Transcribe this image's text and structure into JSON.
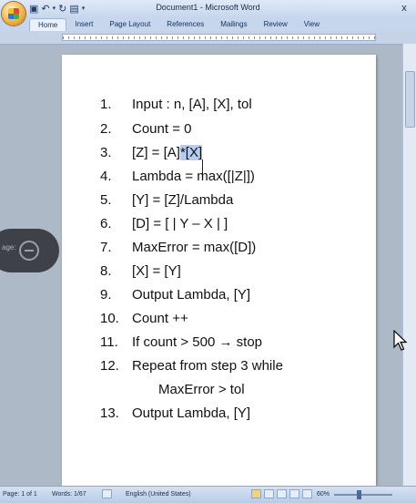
{
  "window": {
    "title": "Document1 - Microsoft Word",
    "close_glyph": "x"
  },
  "ribbon": {
    "tabs": [
      "Home",
      "Insert",
      "Page Layout",
      "References",
      "Mailings",
      "Review",
      "View"
    ]
  },
  "document": {
    "lines": [
      {
        "num": "1.",
        "text": "Input : n, [A], [X], tol"
      },
      {
        "num": "2.",
        "text": "Count = 0"
      },
      {
        "num": "3.",
        "text_before": "[Z] = [A]",
        "text_selected": "*[X]"
      },
      {
        "num": "4.",
        "text": "Lambda = max([|Z|])"
      },
      {
        "num": "5.",
        "text": "[Y] = [Z]/Lambda"
      },
      {
        "num": "6.",
        "text": "[D] = [ | Y – X | ]"
      },
      {
        "num": "7.",
        "text": "MaxError = max([D])"
      },
      {
        "num": "8.",
        "text": "[X] = [Y]"
      },
      {
        "num": "9.",
        "text": "Output Lambda, [Y]"
      },
      {
        "num": "10.",
        "text": "Count ++"
      },
      {
        "num": "11.",
        "text": "If count > 500 → stop"
      },
      {
        "num": "12.",
        "text": "Repeat from step 3 while"
      },
      {
        "num": "",
        "text": "MaxError > tol"
      },
      {
        "num": "13.",
        "text": "Output Lambda, [Y]"
      }
    ]
  },
  "overlay": {
    "label": "age:"
  },
  "statusbar": {
    "page": "Page: 1 of 1",
    "words": "Words: 1/67",
    "language": "English (United States)",
    "zoom": "60%"
  },
  "icons": {
    "save": "save-icon",
    "undo": "undo-icon",
    "redo": "redo-icon",
    "print_preview": "print-preview-icon",
    "proofing": "proofing-icon",
    "zoom_out": "zoom-out-icon",
    "zoom_in": "zoom-in-icon"
  }
}
